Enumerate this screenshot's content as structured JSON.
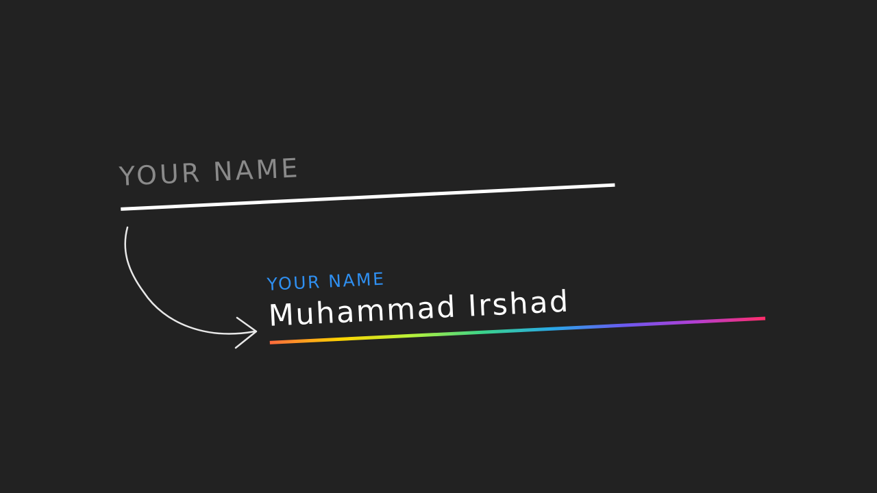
{
  "colors": {
    "background": "#222222",
    "placeholder": "#8a8a8a",
    "floating_label": "#2f8ff0",
    "value_text": "#ffffff",
    "underline_plain": "#ffffff",
    "underline_gradient": [
      "#ff6a3d",
      "#ffd400",
      "#b7f23a",
      "#3bd38a",
      "#2aa8e8",
      "#6a5af0",
      "#b23fd4",
      "#ff2d6a"
    ]
  },
  "empty_field": {
    "placeholder": "YOUR NAME"
  },
  "filled_field": {
    "label": "YOUR NAME",
    "value": "Muhammad Irshad"
  },
  "icons": {
    "arrow": "curved-arrow-icon"
  }
}
